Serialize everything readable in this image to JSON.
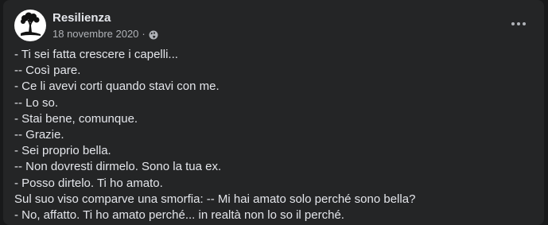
{
  "post": {
    "author": "Resilienza",
    "date": "18 novembre 2020",
    "separator": "·",
    "privacy_icon": "globe-icon",
    "more_icon": "more-options-icon",
    "lines": [
      "- Ti sei fatta crescere i capelli...",
      "-- Così pare.",
      "- Ce li avevi corti quando stavi con me.",
      "-- Lo so.",
      "- Stai bene, comunque.",
      "-- Grazie.",
      "- Sei proprio bella.",
      "-- Non dovresti dirmelo. Sono la tua ex.",
      "- Posso dirtelo. Ti ho amato.",
      "Sul suo viso comparve una smorfia: -- Mi hai amato solo perché sono bella?",
      "- No, affatto. Ti ho amato perché... in realtà non lo so il perché."
    ]
  },
  "colors": {
    "background": "#18191a",
    "card": "#242526",
    "primary_text": "#e4e6eb",
    "secondary_text": "#b0b3b8"
  }
}
